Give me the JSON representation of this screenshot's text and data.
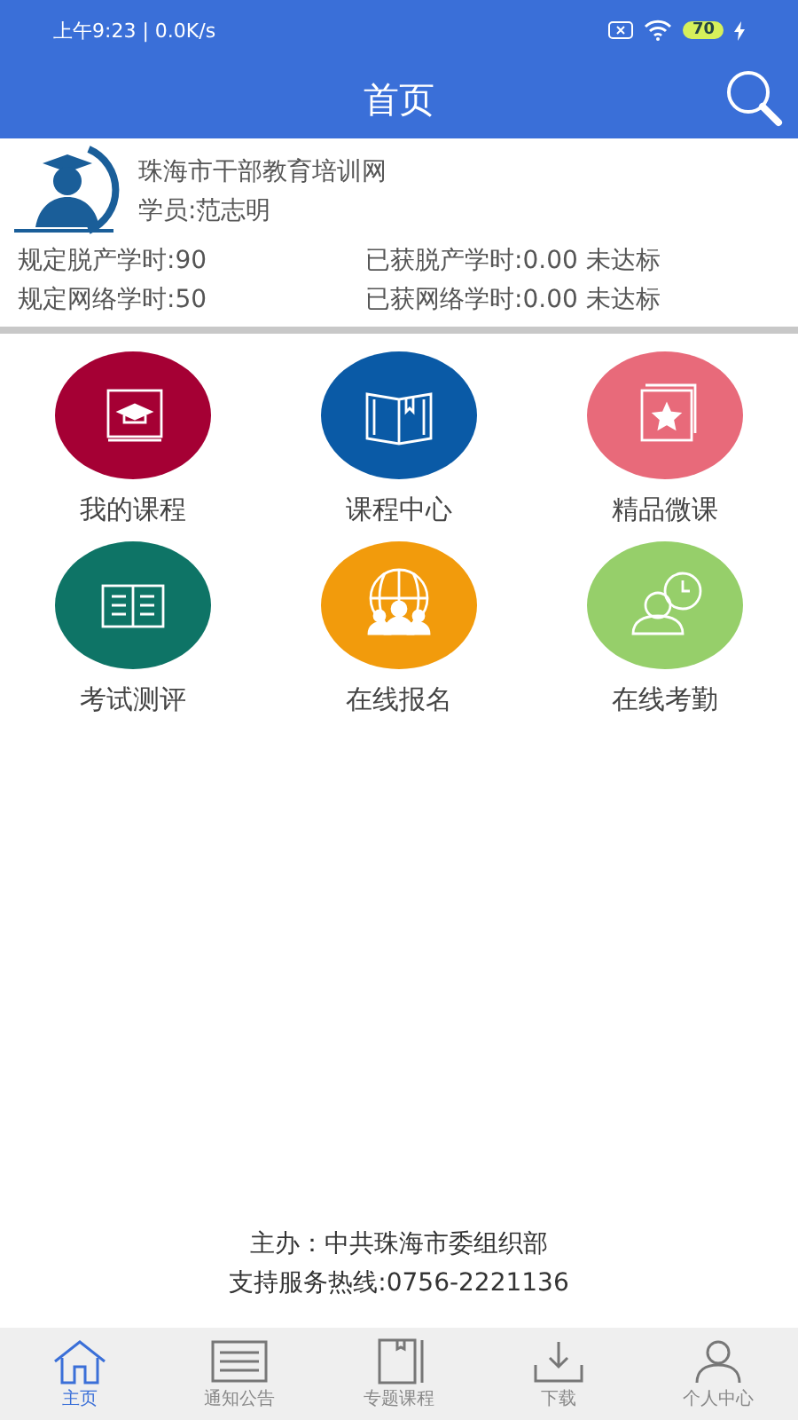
{
  "status_bar": {
    "time": "上午9:23 | 0.0K/s",
    "battery": "70"
  },
  "header": {
    "title": "首页"
  },
  "profile": {
    "site": "珠海市干部教育培训网",
    "student": "学员:范志明"
  },
  "stats": [
    {
      "required": "规定脱产学时:90",
      "earned": "已获脱产学时:0.00 未达标"
    },
    {
      "required": "规定网络学时:50",
      "earned": "已获网络学时:0.00 未达标"
    }
  ],
  "tiles": [
    {
      "label": "我的课程",
      "kind": "course-book",
      "color": "#a50034"
    },
    {
      "label": "课程中心",
      "kind": "open-book",
      "color": "#0a5aa6"
    },
    {
      "label": "精品微课",
      "kind": "star-window",
      "color": "#e86a7a"
    },
    {
      "label": "考试测评",
      "kind": "exam-book",
      "color": "#0e7466"
    },
    {
      "label": "在线报名",
      "kind": "people-globe",
      "color": "#f29b0c"
    },
    {
      "label": "在线考勤",
      "kind": "person-clock",
      "color": "#96cf6a"
    }
  ],
  "footer": {
    "organizer": "主办：中共珠海市委组织部",
    "hotline": "支持服务热线:0756-2221136"
  },
  "tabs": [
    {
      "label": "主页",
      "kind": "home",
      "selected": true
    },
    {
      "label": "通知公告",
      "kind": "list",
      "selected": false
    },
    {
      "label": "专题课程",
      "kind": "book",
      "selected": false
    },
    {
      "label": "下载",
      "kind": "download",
      "selected": false
    },
    {
      "label": "个人中心",
      "kind": "person",
      "selected": false
    }
  ]
}
